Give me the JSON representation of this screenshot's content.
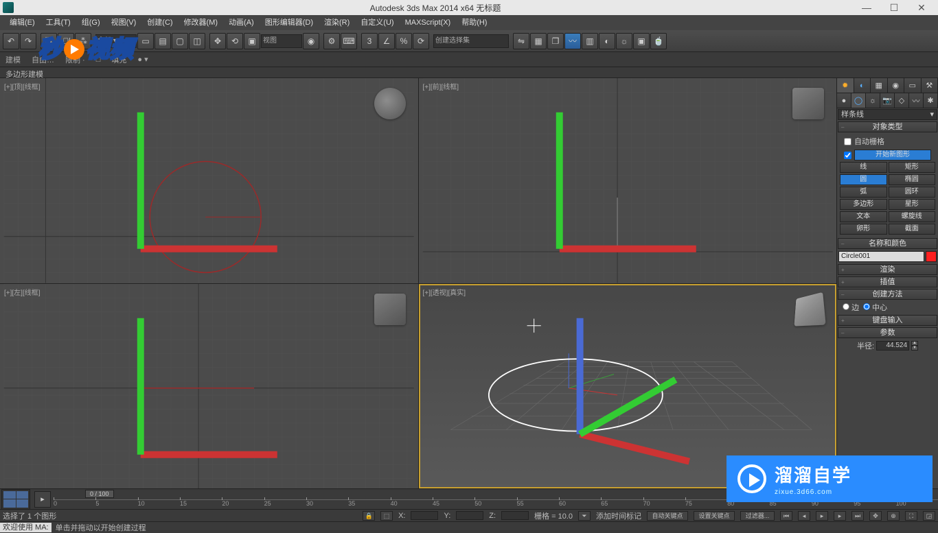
{
  "title": "Autodesk 3ds Max  2014 x64     无标题",
  "menu": [
    "编辑(E)",
    "工具(T)",
    "组(G)",
    "视图(V)",
    "创建(C)",
    "修改器(M)",
    "动画(A)",
    "图形编辑器(D)",
    "渲染(R)",
    "自定义(U)",
    "MAXScript(X)",
    "帮助(H)"
  ],
  "toolbar_dropdowns": {
    "view": "视图",
    "select_filter": "创建选择集"
  },
  "ribbon": {
    "tab1": "建模",
    "tab2": "限制",
    "tab3": "填充"
  },
  "polymode": "多边形建模",
  "viewports": {
    "tl": "[+][顶][线框]",
    "tr": "[+][前][线框]",
    "bl": "[+][左][线框]",
    "br": "[+][透视][真实]"
  },
  "cmd": {
    "dropdown": "样条线",
    "objtype_hdr": "对象类型",
    "autogrid": "自动栅格",
    "startnew": "开始新图形",
    "buttons": [
      [
        "线",
        "矩形"
      ],
      [
        "圆",
        "椭圆"
      ],
      [
        "弧",
        "圆环"
      ],
      [
        "多边形",
        "星形"
      ],
      [
        "文本",
        "螺旋线"
      ],
      [
        "卵形",
        "截面"
      ]
    ],
    "active_btn": "圆",
    "namecolor_hdr": "名称和颜色",
    "objname": "Circle001",
    "render_hdr": "渲染",
    "interp_hdr": "插值",
    "method_hdr": "创建方法",
    "method_edge": "边",
    "method_center": "中心",
    "kbd_hdr": "键盘输入",
    "params_hdr": "参数",
    "radius_lbl": "半径:",
    "radius_val": "44.524"
  },
  "timeline": {
    "handle": "0 / 100",
    "ticks": [
      "0",
      "5",
      "10",
      "15",
      "20",
      "25",
      "30",
      "35",
      "40",
      "45",
      "50",
      "55",
      "60",
      "65",
      "70",
      "75",
      "80",
      "85",
      "90",
      "95",
      "100"
    ]
  },
  "status": {
    "sel": "选择了 1 个图形",
    "x": "X:",
    "y": "Y:",
    "z": "Z:",
    "grid": "栅格 = 10.0",
    "addtime": "添加时间标记",
    "autokey": "自动关键点",
    "setkey": "设置关键点",
    "filter": "过滤器..."
  },
  "prompt": {
    "welcome": "欢迎使用 MA:",
    "hint": "单击并拖动以开始创建过程"
  },
  "watermark1": "秒 dong 视频",
  "watermark2": {
    "main": "溜溜自学",
    "sub": "zixue.3d66.com"
  }
}
